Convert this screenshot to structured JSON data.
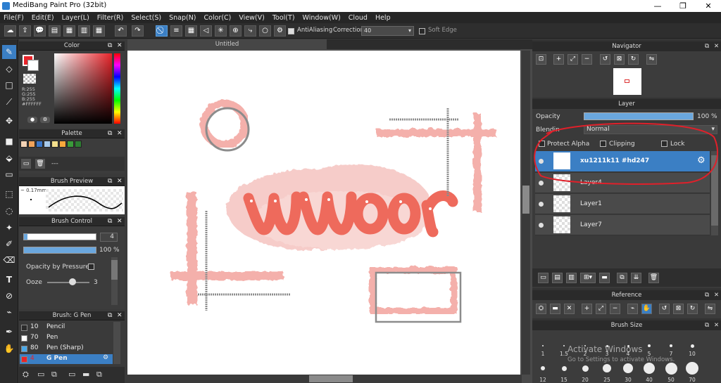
{
  "window": {
    "title": "MediBang Paint Pro (32bit)",
    "controls": {
      "minimize": "—",
      "maximize": "❐",
      "close": "✕"
    }
  },
  "menu": [
    "File(F)",
    "Edit(E)",
    "Layer(L)",
    "Filter(R)",
    "Select(S)",
    "Snap(N)",
    "Color(C)",
    "View(V)",
    "Tool(T)",
    "Window(W)",
    "Cloud",
    "Help"
  ],
  "toolbar": {
    "antialiasing_label": "AntiAliasing",
    "antialiasing_checked": true,
    "correction_label": "Correction",
    "correction_value": "40",
    "soft_edge_label": "Soft Edge",
    "soft_edge_checked": false
  },
  "color_panel": {
    "title": "Color",
    "rgb": [
      "R:255",
      "G:255",
      "B:255"
    ],
    "hex": "#FFFFFF",
    "primary_color": "#e8242a",
    "secondary_color": "#ffffff"
  },
  "palette_panel": {
    "title": "Palette",
    "swatches": [
      "#f3d3b5",
      "#f0a35a",
      "#3a76c8",
      "#a7c9ea",
      "#f4df8c",
      "#f7a83c",
      "#3a9b3a",
      "#2e7d32"
    ],
    "name": "---"
  },
  "brush_preview": {
    "title": "Brush Preview",
    "size": "0.17mm"
  },
  "brush_control": {
    "title": "Brush Control",
    "width_value": "4",
    "opacity_value": "100 %",
    "opacity_by_pressure_label": "Opacity by Pressure",
    "ooze_label": "Ooze",
    "ooze_value": "3"
  },
  "brush_list": {
    "title": "Brush: G Pen",
    "items": [
      {
        "size": "10",
        "name": "Pencil",
        "color": "#2b2b2b"
      },
      {
        "size": "70",
        "name": "Pen",
        "color": "#ffffff"
      },
      {
        "size": "80",
        "name": "Pen (Sharp)",
        "color": "#4aa8e8"
      },
      {
        "size": "4",
        "name": "G Pen",
        "color": "#e8242a"
      }
    ],
    "selected_index": 3
  },
  "canvas": {
    "tab_title": "Untitled"
  },
  "navigator": {
    "title": "Navigator"
  },
  "layer_panel": {
    "title": "Layer",
    "opacity_label": "Opacity",
    "opacity_value": "100 %",
    "blending_label": "Blendin",
    "blending_value": "Normal",
    "protect_alpha_label": "Protect Alpha",
    "clipping_label": "Clipping",
    "lock_label": "Lock",
    "layers": [
      {
        "name": "xu1211k11 #hd247",
        "selected": true
      },
      {
        "name": "Layer4",
        "selected": false
      },
      {
        "name": "Layer1",
        "selected": false
      },
      {
        "name": "Layer7",
        "selected": false
      }
    ]
  },
  "reference_panel": {
    "title": "Reference"
  },
  "brush_size_panel": {
    "title": "Brush Size",
    "row1": [
      "1",
      "1.5",
      "2",
      "3",
      "4",
      "5",
      "7",
      "10"
    ],
    "row2": [
      "12",
      "15",
      "20",
      "25",
      "30",
      "40",
      "50",
      "70"
    ]
  },
  "watermark": {
    "line1": "Activate Windows",
    "line2": "Go to Settings to activate Windows."
  },
  "accent_color": "#3b7fc4",
  "annotation_color": "#e0202a"
}
